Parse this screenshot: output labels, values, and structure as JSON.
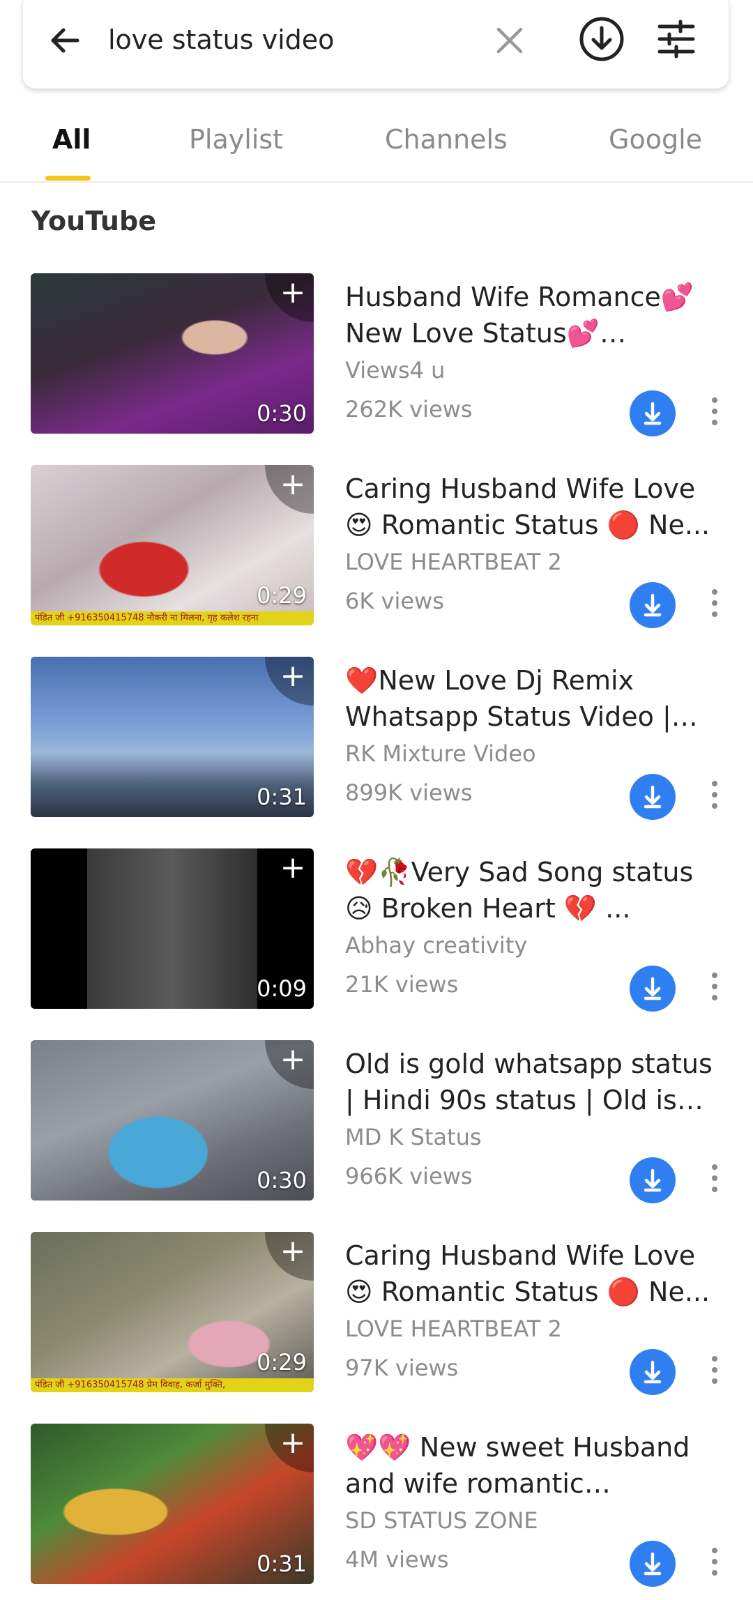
{
  "search": {
    "query": "love status video"
  },
  "tabs": [
    {
      "label": "All"
    },
    {
      "label": "Playlist"
    },
    {
      "label": "Channels"
    },
    {
      "label": "Google"
    }
  ],
  "section": {
    "title": "YouTube"
  },
  "icons": {
    "add": "+",
    "back": "arrow-left-icon",
    "clear": "close-icon",
    "download": "download-circle-icon",
    "filter": "sliders-icon",
    "more": "more-vertical-icon"
  },
  "results": [
    {
      "title": "Husband Wife Romance💕 New Love Status💕 Romant...",
      "channel": "Views4 u",
      "views": "262K views",
      "duration": "0:30"
    },
    {
      "title": "Caring Husband Wife Love 😍 Romantic Status 🔴 Ne...",
      "channel": "LOVE HEARTBEAT 2",
      "views": "6K views",
      "duration": "0:29",
      "banner": "पंडित जी +916350415748 नौकरी ना मिलना, गृह कलेश रहना"
    },
    {
      "title": "❤️New Love Dj Remix Whatsapp Status Video | Hi...",
      "channel": "RK Mixture Video",
      "views": "899K views",
      "duration": "0:31"
    },
    {
      "title": "💔🥀Very Sad Song status 😥 Broken Heart 💔 ...",
      "channel": "Abhay creativity",
      "views": "21K views",
      "duration": "0:09"
    },
    {
      "title": "Old is gold whatsapp status | Hindi 90s status | Old is gol...",
      "channel": "MD K Status",
      "views": "966K views",
      "duration": "0:30"
    },
    {
      "title": "Caring Husband Wife Love 😍 Romantic Status 🔴 Ne...",
      "channel": "LOVE HEARTBEAT 2",
      "views": "97K views",
      "duration": "0:29",
      "banner": "पंडित जी +916350415748 प्रेम विवाह, कर्जा मुक्ति,"
    },
    {
      "title": "💖💖 New sweet Husband and wife romantic Whatsap...",
      "channel": "SD STATUS ZONE",
      "views": "4M views",
      "duration": "0:31"
    }
  ],
  "colors": {
    "accent": "#f5c518",
    "download": "#2f7ff0"
  }
}
